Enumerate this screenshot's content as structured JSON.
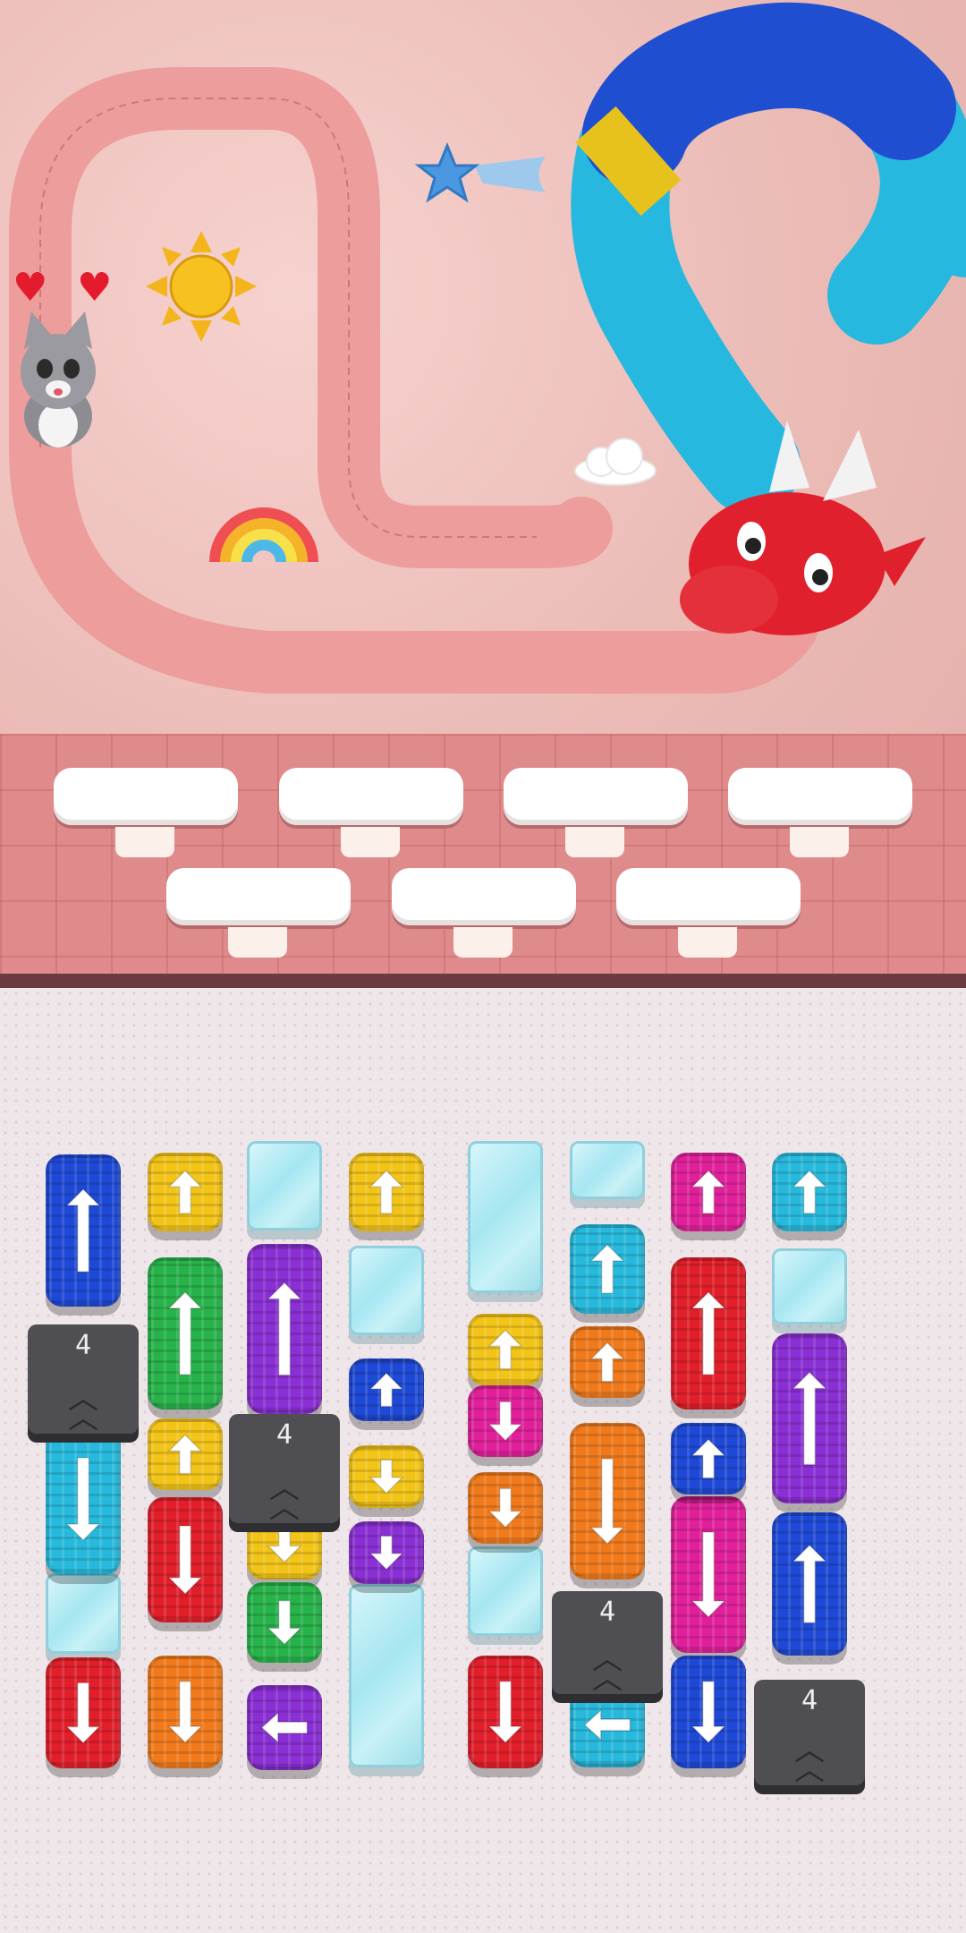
{
  "hud": {
    "lives": [
      "heart",
      "heart"
    ],
    "heart_color": "#e31b2d"
  },
  "scene": {
    "character": "cat",
    "decorations": [
      "sun-patch",
      "star-patch",
      "rainbow-patch",
      "cloud-patch",
      "dragon"
    ],
    "dragon_colors": {
      "head": "#e0202c",
      "body": "#27b8e0",
      "back": "#1f4fd0",
      "band": "#e8c21c"
    }
  },
  "shelf": {
    "slot_count": 7,
    "filled": 0
  },
  "board": {
    "colors": {
      "blue": "#1e49d6",
      "yellow": "#f2c418",
      "green": "#27b34a",
      "purple": "#8a2fd3",
      "cyan": "#27b9dc",
      "red": "#e11f2a",
      "orange": "#f07a1b",
      "magenta": "#e0209a"
    },
    "tiles": [
      {
        "color": "blue",
        "dir": "up"
      },
      {
        "color": "yellow",
        "dir": "up"
      },
      {
        "color": "yellow",
        "dir": "up"
      },
      {
        "color": "magenta",
        "dir": "up"
      },
      {
        "color": "cyan",
        "dir": "up"
      },
      {
        "color": "green",
        "dir": "up"
      },
      {
        "color": "purple",
        "dir": "up"
      },
      {
        "color": "cyan",
        "dir": "up"
      },
      {
        "color": "red",
        "dir": "up"
      },
      {
        "color": "yellow",
        "dir": "up"
      },
      {
        "color": "orange",
        "dir": "up"
      },
      {
        "color": "blue",
        "dir": "up"
      },
      {
        "color": "magenta",
        "dir": "down"
      },
      {
        "color": "purple",
        "dir": "up"
      },
      {
        "color": "cyan",
        "dir": "down"
      },
      {
        "color": "yellow",
        "dir": "up"
      },
      {
        "color": "yellow",
        "dir": "down"
      },
      {
        "color": "orange",
        "dir": "down"
      },
      {
        "color": "orange",
        "dir": "down"
      },
      {
        "color": "blue",
        "dir": "up"
      },
      {
        "color": "red",
        "dir": "down"
      },
      {
        "color": "yellow",
        "dir": "down"
      },
      {
        "color": "purple",
        "dir": "down"
      },
      {
        "color": "magenta",
        "dir": "down"
      },
      {
        "color": "blue",
        "dir": "up"
      },
      {
        "color": "green",
        "dir": "down"
      },
      {
        "color": "red",
        "dir": "down"
      },
      {
        "color": "orange",
        "dir": "down"
      },
      {
        "color": "purple",
        "dir": "left"
      },
      {
        "color": "red",
        "dir": "down"
      },
      {
        "color": "cyan",
        "dir": "left"
      },
      {
        "color": "blue",
        "dir": "down"
      }
    ],
    "gates": [
      {
        "label": "4"
      },
      {
        "label": "4"
      },
      {
        "label": "4"
      },
      {
        "label": "4"
      }
    ],
    "ice_blocks": 9
  }
}
